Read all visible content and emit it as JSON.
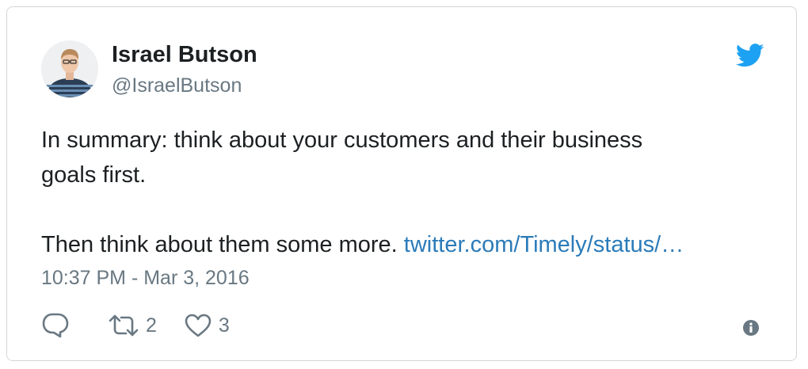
{
  "author": {
    "display_name": "Israel Butson",
    "handle": "@IsraelButson"
  },
  "tweet": {
    "line1": "In summary: think about your customers and their business",
    "line2": "goals first.",
    "line3_text": "Then think about them some more. ",
    "link_text": "twitter.com/Timely/status/…",
    "timestamp": "10:37 PM - Mar 3, 2016"
  },
  "actions": {
    "retweet_count": "2",
    "like_count": "3"
  },
  "icons": {
    "brand": "twitter-bird-icon",
    "reply": "reply-icon",
    "retweet": "retweet-icon",
    "like": "heart-icon",
    "info": "info-icon"
  },
  "colors": {
    "text": "#1c2022",
    "secondary": "#697882",
    "link": "#2b7bb9",
    "brand": "#1da1f2",
    "border": "#d2d6d9"
  }
}
